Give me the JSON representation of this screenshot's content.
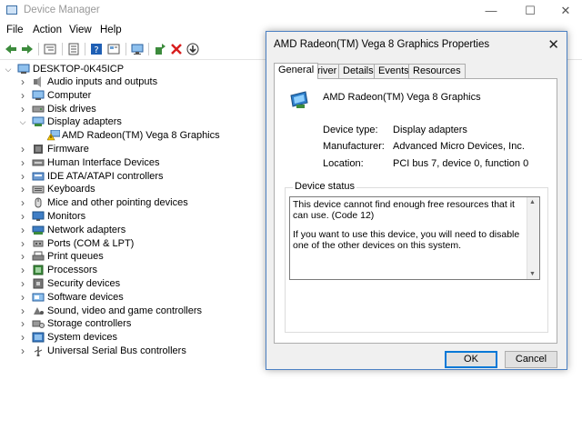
{
  "window": {
    "title": "Device Manager",
    "minimize": "—",
    "maximize": "☐",
    "close": "✕"
  },
  "menu": [
    "File",
    "Action",
    "View",
    "Help"
  ],
  "tree": {
    "root": "DESKTOP-0K45ICP",
    "items": [
      {
        "label": "Audio inputs and outputs",
        "icon": "speaker-icon",
        "state": "collapsed"
      },
      {
        "label": "Computer",
        "icon": "computer-icon",
        "state": "collapsed"
      },
      {
        "label": "Disk drives",
        "icon": "disk-drive-icon",
        "state": "collapsed"
      },
      {
        "label": "Display adapters",
        "icon": "display-adapter-icon",
        "state": "expanded"
      },
      {
        "label": "AMD Radeon(TM) Vega 8 Graphics",
        "icon": "warning-display-icon",
        "state": "child"
      },
      {
        "label": "Firmware",
        "icon": "firmware-icon",
        "state": "collapsed"
      },
      {
        "label": "Human Interface Devices",
        "icon": "hid-icon",
        "state": "collapsed"
      },
      {
        "label": "IDE ATA/ATAPI controllers",
        "icon": "ide-controller-icon",
        "state": "collapsed"
      },
      {
        "label": "Keyboards",
        "icon": "keyboard-icon",
        "state": "collapsed"
      },
      {
        "label": "Mice and other pointing devices",
        "icon": "mouse-icon",
        "state": "collapsed"
      },
      {
        "label": "Monitors",
        "icon": "monitor-icon",
        "state": "collapsed"
      },
      {
        "label": "Network adapters",
        "icon": "network-adapter-icon",
        "state": "collapsed"
      },
      {
        "label": "Ports (COM & LPT)",
        "icon": "port-icon",
        "state": "collapsed"
      },
      {
        "label": "Print queues",
        "icon": "printer-icon",
        "state": "collapsed"
      },
      {
        "label": "Processors",
        "icon": "processor-icon",
        "state": "collapsed"
      },
      {
        "label": "Security devices",
        "icon": "security-device-icon",
        "state": "collapsed"
      },
      {
        "label": "Software devices",
        "icon": "software-device-icon",
        "state": "collapsed"
      },
      {
        "label": "Sound, video and game controllers",
        "icon": "sound-controller-icon",
        "state": "collapsed"
      },
      {
        "label": "Storage controllers",
        "icon": "storage-controller-icon",
        "state": "collapsed"
      },
      {
        "label": "System devices",
        "icon": "system-device-icon",
        "state": "collapsed"
      },
      {
        "label": "Universal Serial Bus controllers",
        "icon": "usb-icon",
        "state": "collapsed"
      }
    ]
  },
  "dialog": {
    "title": "AMD Radeon(TM) Vega 8 Graphics Properties",
    "close": "✕",
    "tabs": [
      "General",
      "Driver",
      "Details",
      "Events",
      "Resources"
    ],
    "active_tab": "General",
    "device_name": "AMD Radeon(TM) Vega 8 Graphics",
    "props": [
      {
        "key": "Device type:",
        "value": "Display adapters"
      },
      {
        "key": "Manufacturer:",
        "value": "Advanced Micro Devices, Inc."
      },
      {
        "key": "Location:",
        "value": "PCI bus 7, device 0, function 0"
      }
    ],
    "status_title": "Device status",
    "status_line1": "This device cannot find enough free resources that it can use. (Code 12)",
    "status_line2": "If you want to use this device, you will need to disable one of the other devices on this system.",
    "ok": "OK",
    "cancel": "Cancel"
  },
  "colors": {
    "accent": "#0078d7",
    "warning": "#f2c200",
    "dialog_border": "#4b80c3"
  }
}
